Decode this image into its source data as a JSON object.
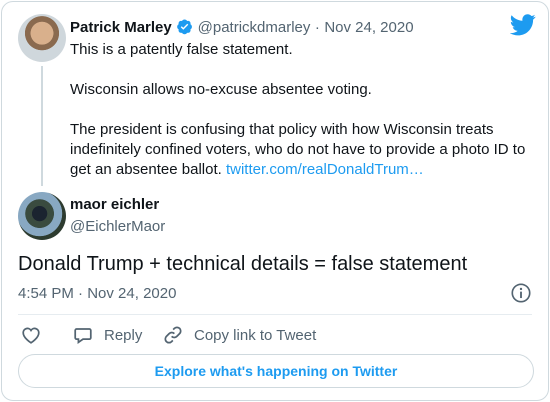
{
  "quoted_tweet": {
    "author_name": "Patrick Marley",
    "author_handle": "@patrickdmarley",
    "separator": "·",
    "date": "Nov 24, 2020",
    "paragraphs": [
      "This is a patently false statement.",
      "Wisconsin allows no-excuse absentee voting.",
      "The president is confusing that policy with how Wisconsin treats indefinitely confined voters, who do not have to provide a photo ID to get an absentee ballot."
    ],
    "link_text": "twitter.com/realDonaldTrum…"
  },
  "reply_tweet": {
    "author_name": "maor eichler",
    "author_handle": "@EichlerMaor",
    "text": "Donald Trump + technical details = false statement",
    "time": "4:54 PM",
    "separator": "·",
    "date": "Nov 24, 2020"
  },
  "actions": {
    "reply_label": "Reply",
    "copy_link_label": "Copy link to Tweet"
  },
  "explore_label": "Explore what's happening on Twitter",
  "icons": {
    "brand": "twitter-bird-icon",
    "verified": "verified-badge-icon",
    "info": "info-icon",
    "like": "heart-icon",
    "reply": "reply-icon",
    "link": "link-icon"
  },
  "colors": {
    "accent": "#1d9bf0",
    "text": "#0f1419",
    "muted": "#536471",
    "border": "#cfd9de"
  }
}
